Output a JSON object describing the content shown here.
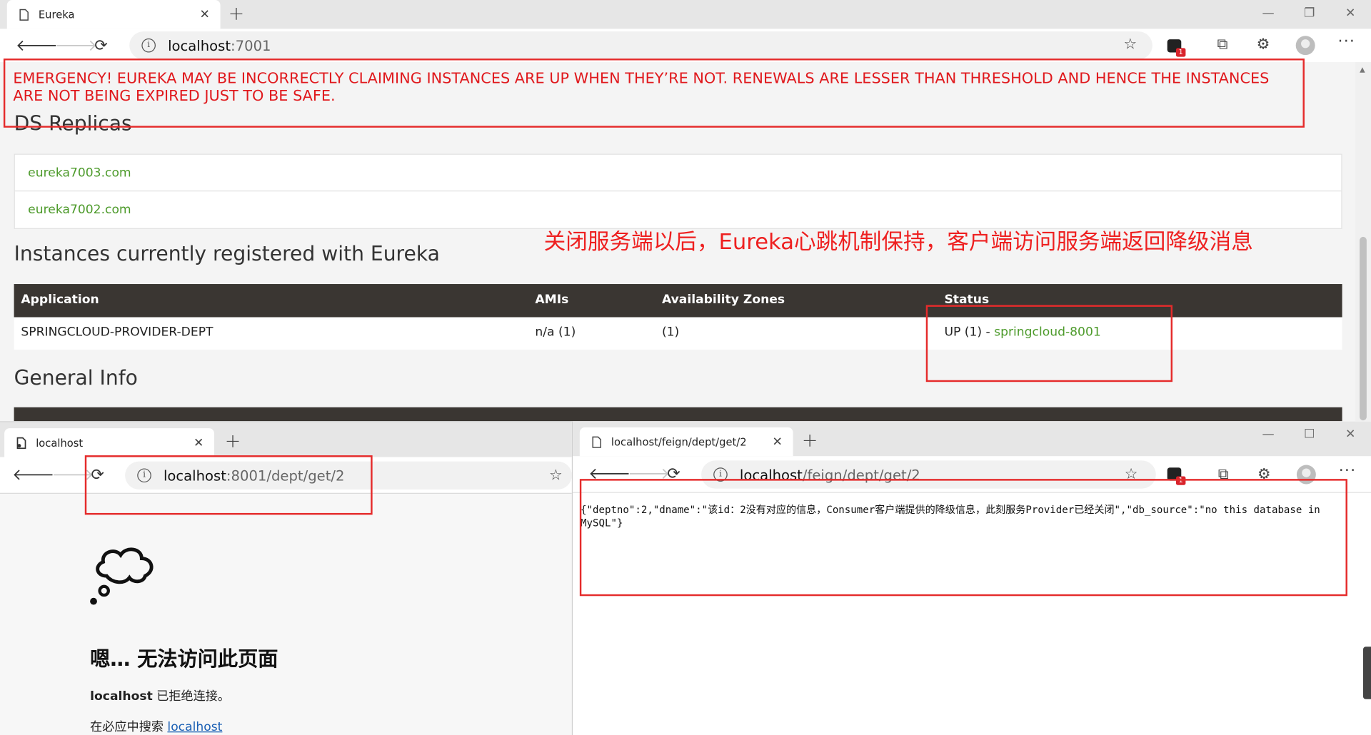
{
  "eureka_window": {
    "tab_title": "Eureka",
    "url_host": "localhost",
    "url_rest": ":7001",
    "emergency": "EMERGENCY! EUREKA MAY BE INCORRECTLY CLAIMING INSTANCES ARE UP WHEN THEY’RE NOT. RENEWALS ARE LESSER THAN THRESHOLD AND HENCE THE INSTANCES ARE NOT BEING EXPIRED JUST TO BE SAFE.",
    "ds_replicas_title": "DS Replicas",
    "replicas": [
      "eureka7003.com",
      "eureka7002.com"
    ],
    "instances_title": "Instances currently registered with Eureka",
    "table": {
      "headers": [
        "Application",
        "AMIs",
        "Availability Zones",
        "Status"
      ],
      "row": {
        "application": "SPRINGCLOUD-PROVIDER-DEPT",
        "amis": "n/a (1)",
        "zones": "(1)",
        "status_prefix": "UP (1) - ",
        "status_link": "springcloud-8001"
      }
    },
    "general_info_title": "General Info",
    "extension_badge": "1"
  },
  "annotation_text": "关闭服务端以后，Eureka心跳机制保持，客户端访问服务端返回降级消息",
  "provider_window": {
    "tab_title": "localhost",
    "url_host": "localhost",
    "url_rest": ":8001/dept/get/2",
    "error_title": "嗯… 无法访问此页面",
    "error_host": "localhost",
    "error_msg": " 已拒绝连接。",
    "search_prefix": "在必应中搜索 ",
    "search_link": "localhost"
  },
  "consumer_window": {
    "tab_title": "localhost/feign/dept/get/2",
    "url_host": "localhost",
    "url_rest": "/feign/dept/get/2",
    "json_response": "{\"deptno\":2,\"dname\":\"该id：2没有对应的信息，Consumer客户端提供的降级信息，此刻服务Provider已经关闭\",\"db_source\":\"no this database in MySQL\"}",
    "extension_badge": "1"
  },
  "colors": {
    "emergency": "#e0191d",
    "link_green": "#4c9a2a",
    "table_header": "#3a3632",
    "annotation_red": "#e52b2b"
  }
}
